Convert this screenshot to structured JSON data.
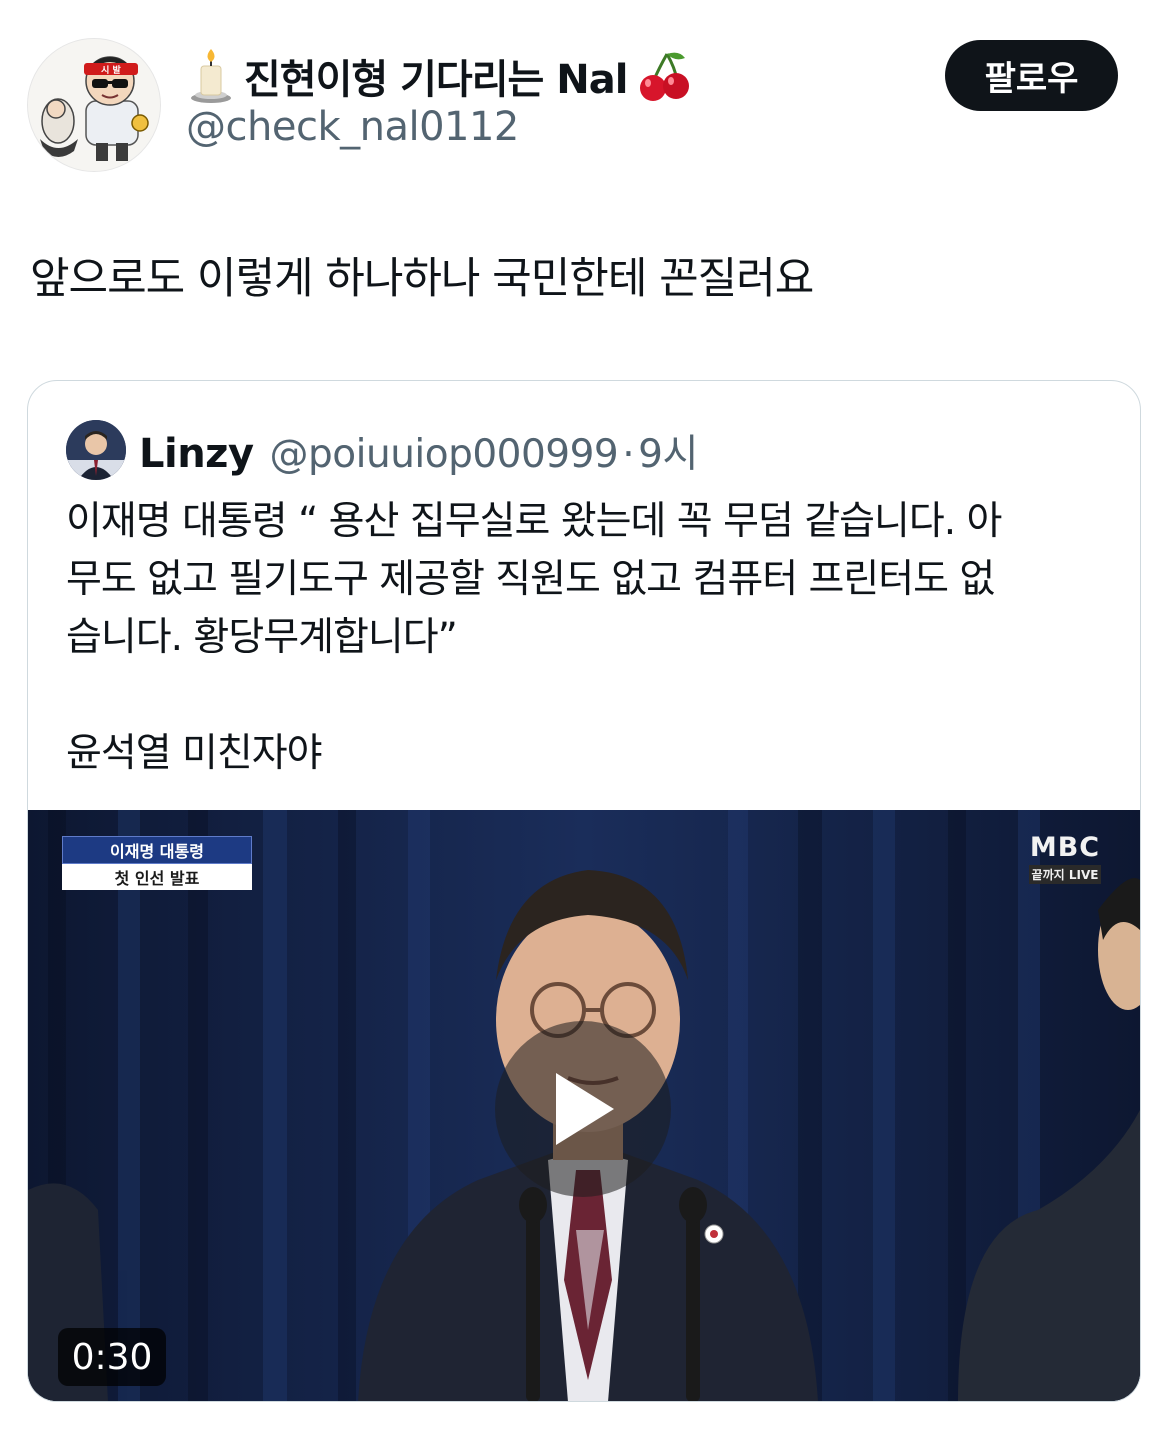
{
  "author": {
    "display_name": "진현이형 기다리는 Nal",
    "handle": "@check_nal0112",
    "avatar_headband_text": "시 발",
    "name_prefix_icon": "candle-icon",
    "name_suffix_icon": "cherry-icon"
  },
  "follow_button": {
    "label": "팔로우"
  },
  "tweet": {
    "text": "앞으로도 이렇게 하나하나 국민한테 꼰질러요"
  },
  "quoted_tweet": {
    "display_name": "Linzy",
    "handle": "@poiuuiop000999",
    "separator": "·",
    "time": "9시",
    "lines": [
      "이재명 대통령 “ 용산 집무실로 왔는데 꼭 무덤 같습니다. 아",
      "무도 없고 필기도구 제공할 직원도 없고 컴퓨터 프린터도 없",
      "습니다. 황당무계합니다”",
      "",
      "윤석열 미친자야"
    ],
    "video": {
      "caption_top": "이재명 대통령",
      "caption_bottom": "첫 인선 발표",
      "broadcaster": "MBC",
      "broadcaster_sub": "끝까지 LIVE",
      "duration": "0:30",
      "play_icon": "play-icon"
    }
  },
  "colors": {
    "text_primary": "#0f1419",
    "text_secondary": "#536471",
    "follow_bg": "#0f1419",
    "border": "#cfd9de",
    "curtain": "#13203d"
  }
}
